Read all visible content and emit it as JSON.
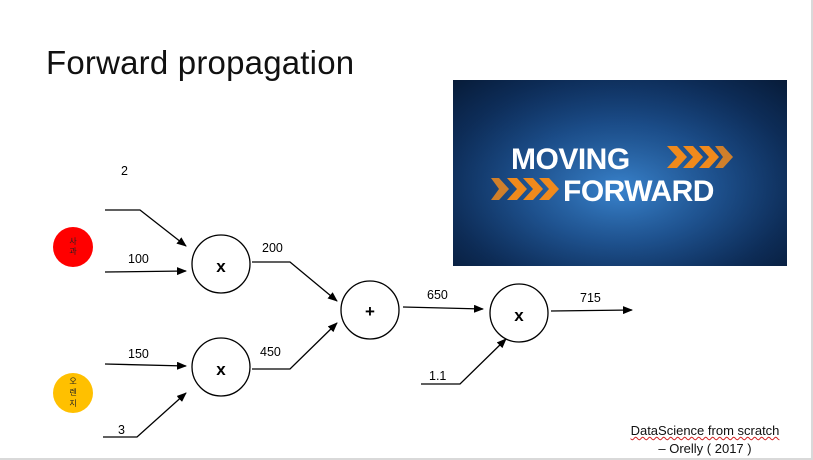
{
  "slide": {
    "title": "Forward propagation",
    "caption_line1": "DataScience from scratch",
    "caption_line2": "– Orelly ( 2017 )"
  },
  "banner": {
    "line1": "MOVING",
    "line2": "FORWARD",
    "colors": {
      "background": "#1a4d8c",
      "text": "#ffffff",
      "chevrons": "#f08a1c"
    }
  },
  "inputs": {
    "apple": {
      "label_line1": "사",
      "label_line2": "과",
      "color": "#ff0000"
    },
    "orange": {
      "label_line1": "오",
      "label_line2": "렌",
      "label_line3": "지",
      "color": "#ffc000"
    }
  },
  "nodes": {
    "mul1": "x",
    "mul2": "x",
    "add": "+",
    "mul3": "x"
  },
  "values": {
    "apple_count": "2",
    "apple_price": "100",
    "orange_price": "150",
    "orange_count": "3",
    "apple_total": "200",
    "orange_total": "450",
    "sum": "650",
    "tax": "1.1",
    "result": "715"
  }
}
